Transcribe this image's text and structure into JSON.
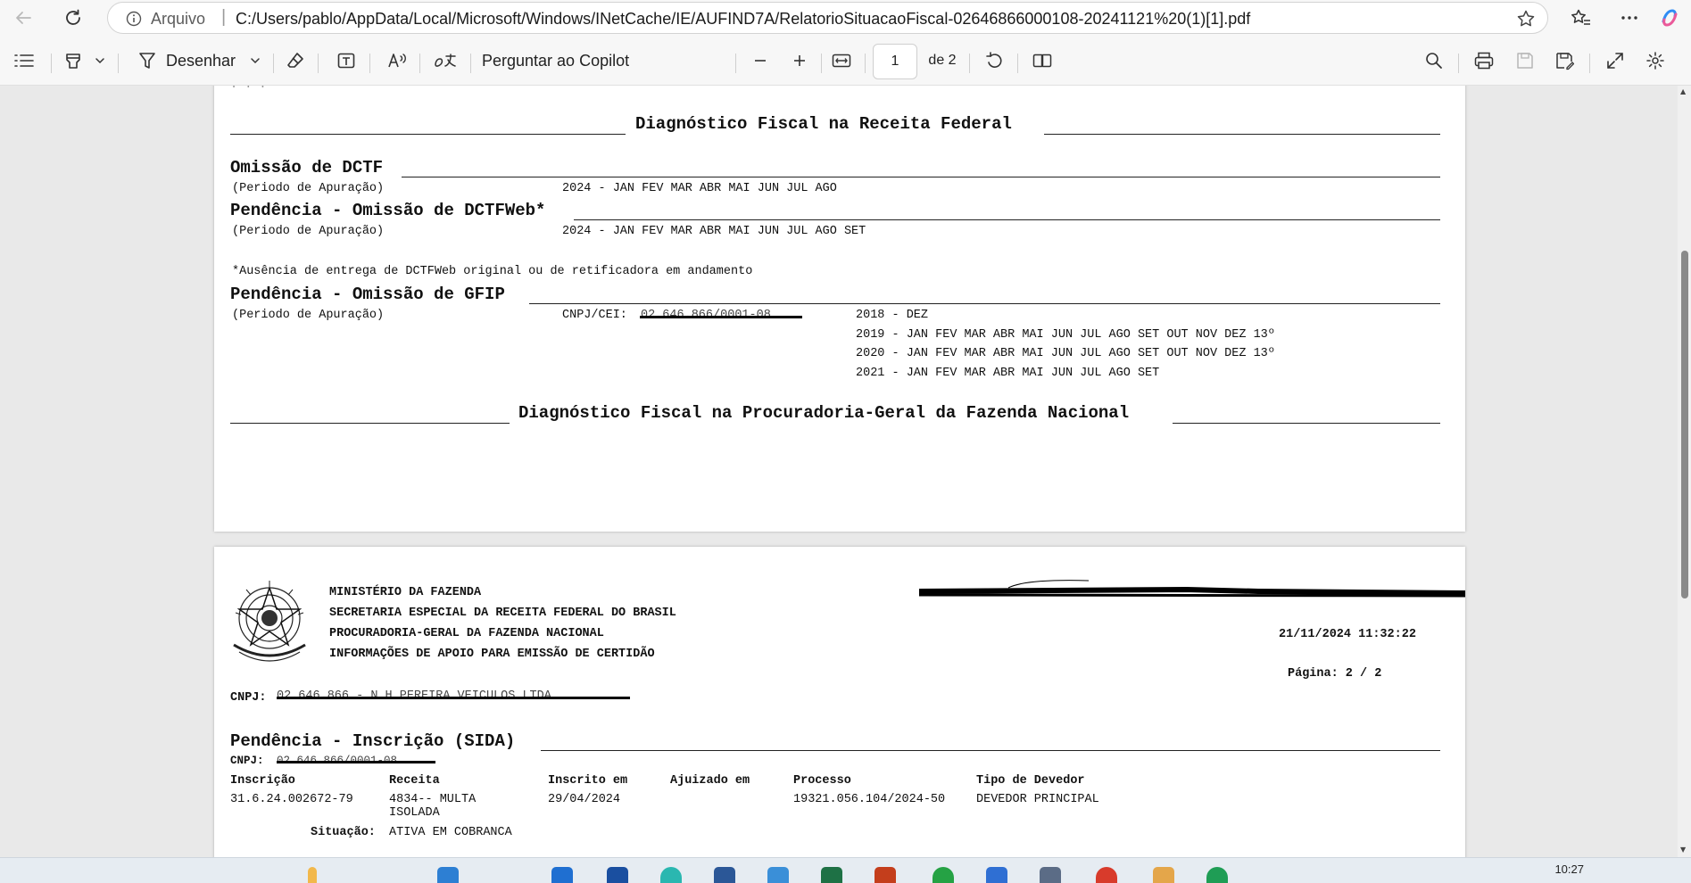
{
  "browser": {
    "url_scheme_label": "Arquivo",
    "url_separator": "|",
    "url": "C:/Users/pablo/AppData/Local/Microsoft/Windows/INetCache/IE/AUFIND7A/RelatorioSituacaoFiscal-02646866000108-20241121%20(1)[1].pdf"
  },
  "toolbar": {
    "draw_label": "Desenhar",
    "copilot_label": "Perguntar ao Copilot",
    "page_current": "1",
    "page_total": "de 2"
  },
  "page1": {
    "receita_heading": "Diagnóstico Fiscal na Receita Federal",
    "omissao_dctf_title": "Omissão de DCTF",
    "periodo_label": "(Periodo de Apuração)",
    "omissao_dctf_period": "2024 - JAN FEV MAR ABR MAI JUN JUL AGO",
    "dctfweb_title": "Pendência - Omissão de DCTFWeb*",
    "dctfweb_period": "2024 - JAN FEV MAR ABR MAI JUN JUL AGO SET",
    "dctfweb_note": "*Ausência de entrega de DCTFWeb original ou de retificadora em andamento",
    "gfip_title": "Pendência - Omissão de GFIP",
    "gfip_cnpj_label": "CNPJ/CEI:",
    "gfip_cnpj_value": "02.646.866/0001-08",
    "gfip_periods": [
      "2018 - DEZ",
      "2019 - JAN FEV MAR ABR MAI JUN JUL AGO SET OUT NOV DEZ 13º",
      "2020 - JAN FEV MAR ABR MAI JUN JUL AGO SET OUT NOV DEZ 13º",
      "2021 - JAN FEV MAR ABR MAI JUN JUL AGO SET"
    ],
    "pgfn_heading": "Diagnóstico Fiscal na Procuradoria-Geral da Fazenda Nacional"
  },
  "page2": {
    "header_lines": [
      "MINISTÉRIO DA FAZENDA",
      "SECRETARIA ESPECIAL DA RECEITA FEDERAL DO BRASIL",
      "PROCURADORIA-GERAL DA FAZENDA NACIONAL",
      "INFORMAÇÕES DE APOIO PARA EMISSÃO DE CERTIDÃO"
    ],
    "datetime": "21/11/2024 11:32:22",
    "page_label": "Página: 2 / 2",
    "cnpj_label": "CNPJ:",
    "cnpj_value": "02.646.866 - N H PEREIRA VEICULOS LTDA",
    "sida_title": "Pendência - Inscrição (SIDA)",
    "sida_cnpj_label": "CNPJ:",
    "sida_cnpj_value": "02.646.866/0001-08",
    "table": {
      "headers": [
        "Inscrição",
        "Receita",
        "Inscrito em",
        "Ajuizado em",
        "Processo",
        "Tipo de Devedor"
      ],
      "row": {
        "inscricao": "31.6.24.002672-79",
        "receita_1": "4834-- MULTA",
        "receita_2": "ISOLADA",
        "inscrito_em": "29/04/2024",
        "ajuizado_em": "",
        "processo": "19321.056.104/2024-50",
        "tipo": "DEVEDOR PRINCIPAL"
      },
      "situacao_label": "Situação:",
      "situacao_value": "ATIVA EM COBRANCA"
    }
  },
  "taskbar": {
    "clock": "10:27"
  },
  "colors": {
    "toolbar_bg": "#f7f7f7",
    "viewer_bg": "#e9e9e9",
    "page_bg": "#ffffff"
  }
}
